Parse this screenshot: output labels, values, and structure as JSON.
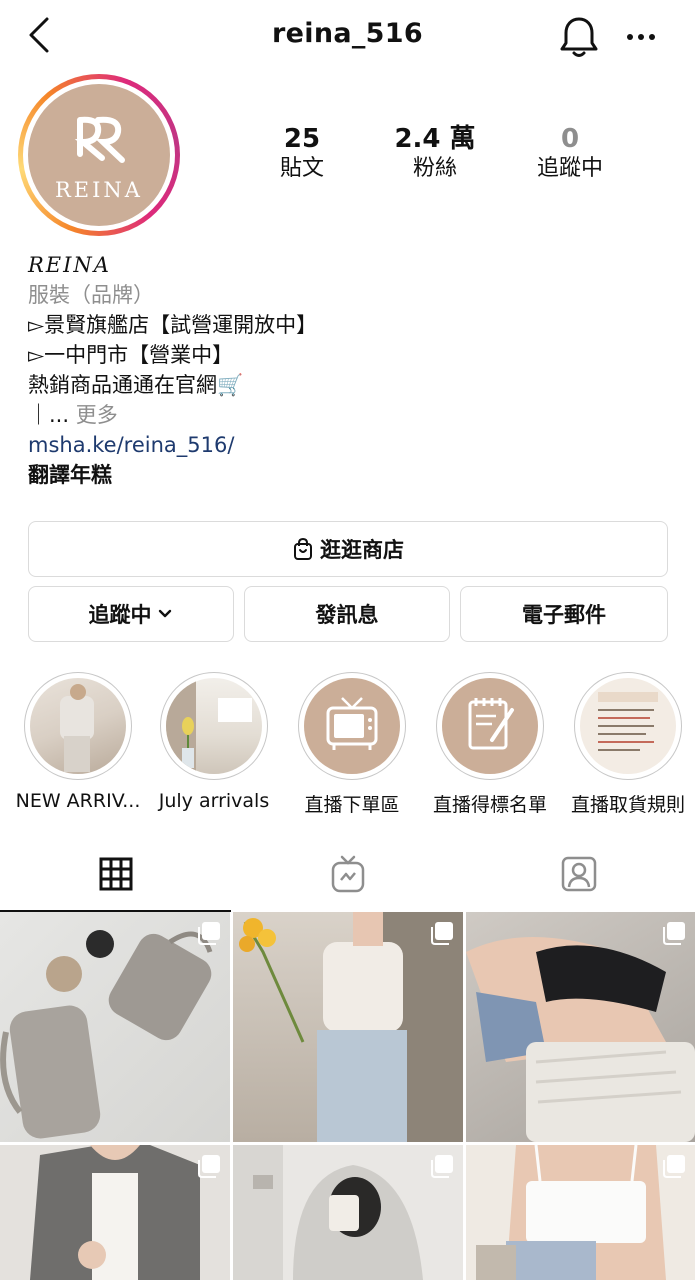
{
  "header": {
    "username": "reina_516"
  },
  "profile": {
    "avatar_text": "REINA",
    "stats": [
      {
        "value": "25",
        "label": "貼文"
      },
      {
        "value": "2.4 萬",
        "label": "粉絲"
      },
      {
        "value": "0",
        "label": "追蹤中"
      }
    ]
  },
  "bio": {
    "name": "REINA",
    "category": "服裝（品牌）",
    "lines": [
      "▻景賢旗艦店【試營運開放中】",
      "▻一中門市【營業中】",
      "熱銷商品通通在官網🛒"
    ],
    "more_prefix": "｜... ",
    "more_label": "更多",
    "link": "msha.ke/reina_516/",
    "translate": "翻譯年糕"
  },
  "buttons": {
    "shop": "逛逛商店",
    "following": "追蹤中",
    "message": "發訊息",
    "email": "電子郵件"
  },
  "highlights": [
    {
      "label": "NEW ARRIV..."
    },
    {
      "label": "July arrivals"
    },
    {
      "label": "直播下單區"
    },
    {
      "label": "直播得標名單"
    },
    {
      "label": "直播取貨規則"
    }
  ],
  "tabs": [
    "grid-icon",
    "igtv-icon",
    "tagged-icon"
  ],
  "colors": {
    "brand_beige": "#cbae98",
    "link": "#1e3a6e",
    "muted": "#8e8e8e"
  }
}
